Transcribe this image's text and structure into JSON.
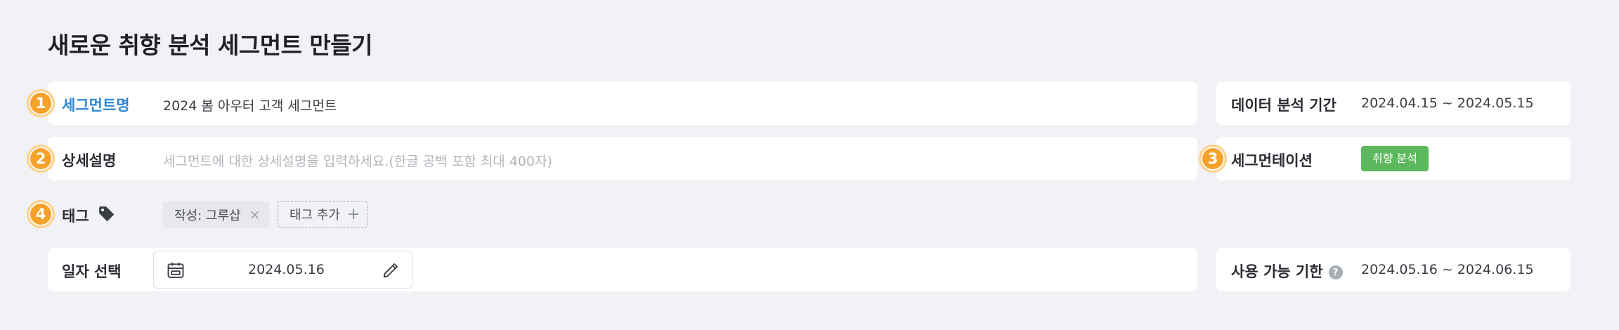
{
  "page": {
    "title": "새로운 취향 분석 세그먼트 만들기"
  },
  "segment_name": {
    "step": "1",
    "label": "세그먼트명",
    "value": "2024 봄 아우터 고객 세그먼트"
  },
  "description": {
    "step": "2",
    "label": "상세설명",
    "placeholder": "세그먼트에 대한 상세설명을 입력하세요.(한글 공백 포함 최대 400자)"
  },
  "tags": {
    "step": "4",
    "label": "태그",
    "icon": "tag-icon",
    "items": [
      {
        "label": "작성: 그루샵",
        "remove_icon": "×"
      }
    ],
    "add_label": "태그 추가",
    "add_icon": "+"
  },
  "date_select": {
    "label": "일자 선택",
    "value": "2024.05.16",
    "icon": "calendar-icon",
    "edit_icon": "pencil-icon"
  },
  "analysis_period": {
    "label": "데이터 분석 기간",
    "value": "2024.04.15 ~ 2024.05.15"
  },
  "segmentation": {
    "step": "3",
    "label": "세그먼테이션",
    "chip": "취향 분석",
    "chip_color": "#5cb85c"
  },
  "available_period": {
    "label": "사용 가능 기한",
    "help": "?",
    "value": "2024.05.16 ~ 2024.06.15"
  },
  "colors": {
    "accent": "#2f86d4",
    "step_badge": "#f5a22b",
    "background": "#f1f2f6"
  }
}
